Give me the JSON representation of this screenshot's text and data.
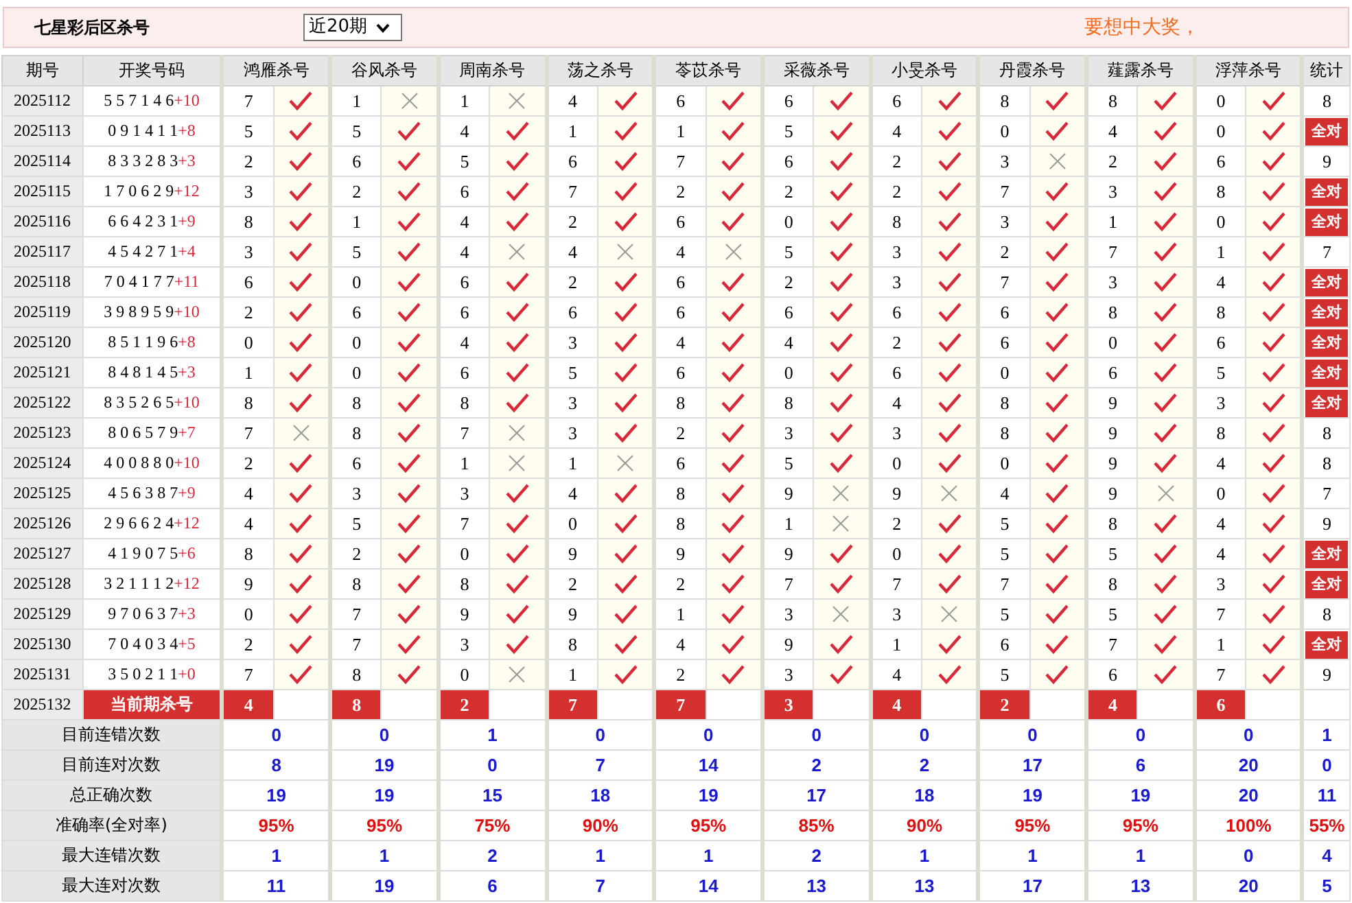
{
  "header": {
    "title": "七星彩后区杀号",
    "period_select": "近20期",
    "promo": "要想中大奖，"
  },
  "table": {
    "columns": [
      "期号",
      "开奖号码",
      "鸿雁杀号",
      "谷风杀号",
      "周南杀号",
      "荡之杀号",
      "苓苡杀号",
      "采薇杀号",
      "小旻杀号",
      "丹霞杀号",
      "薤露杀号",
      "浮萍杀号",
      "统计"
    ],
    "rows": [
      {
        "period": "2025112",
        "draw": "5 5 7 1 4 6",
        "bonus": "+10",
        "numbers": [
          "7",
          "1",
          "1",
          "4",
          "6",
          "6",
          "6",
          "8",
          "8",
          "0"
        ],
        "hits": [
          true,
          false,
          false,
          true,
          true,
          true,
          true,
          true,
          true,
          true
        ],
        "stat": {
          "kind": "count",
          "text": "8"
        }
      },
      {
        "period": "2025113",
        "draw": "0 9 1 4 1 1",
        "bonus": "+8",
        "numbers": [
          "5",
          "5",
          "4",
          "1",
          "1",
          "5",
          "4",
          "0",
          "4",
          "0"
        ],
        "hits": [
          true,
          true,
          true,
          true,
          true,
          true,
          true,
          true,
          true,
          true
        ],
        "stat": {
          "kind": "badge",
          "text": "全对"
        }
      },
      {
        "period": "2025114",
        "draw": "8 3 3 2 8 3",
        "bonus": "+3",
        "numbers": [
          "2",
          "6",
          "5",
          "6",
          "7",
          "6",
          "2",
          "3",
          "2",
          "6"
        ],
        "hits": [
          true,
          true,
          true,
          true,
          true,
          true,
          true,
          false,
          true,
          true
        ],
        "stat": {
          "kind": "count",
          "text": "9"
        }
      },
      {
        "period": "2025115",
        "draw": "1 7 0 6 2 9",
        "bonus": "+12",
        "numbers": [
          "3",
          "2",
          "6",
          "7",
          "2",
          "2",
          "2",
          "7",
          "3",
          "8"
        ],
        "hits": [
          true,
          true,
          true,
          true,
          true,
          true,
          true,
          true,
          true,
          true
        ],
        "stat": {
          "kind": "badge",
          "text": "全对"
        }
      },
      {
        "period": "2025116",
        "draw": "6 6 4 2 3 1",
        "bonus": "+9",
        "numbers": [
          "8",
          "1",
          "4",
          "2",
          "6",
          "0",
          "8",
          "3",
          "1",
          "0"
        ],
        "hits": [
          true,
          true,
          true,
          true,
          true,
          true,
          true,
          true,
          true,
          true
        ],
        "stat": {
          "kind": "badge",
          "text": "全对"
        }
      },
      {
        "period": "2025117",
        "draw": "4 5 4 2 7 1",
        "bonus": "+4",
        "numbers": [
          "3",
          "5",
          "4",
          "4",
          "4",
          "5",
          "3",
          "2",
          "7",
          "1"
        ],
        "hits": [
          true,
          true,
          false,
          false,
          false,
          true,
          true,
          true,
          true,
          true
        ],
        "stat": {
          "kind": "count",
          "text": "7"
        }
      },
      {
        "period": "2025118",
        "draw": "7 0 4 1 7 7",
        "bonus": "+11",
        "numbers": [
          "6",
          "0",
          "6",
          "2",
          "6",
          "2",
          "3",
          "7",
          "3",
          "4"
        ],
        "hits": [
          true,
          true,
          true,
          true,
          true,
          true,
          true,
          true,
          true,
          true
        ],
        "stat": {
          "kind": "badge",
          "text": "全对"
        }
      },
      {
        "period": "2025119",
        "draw": "3 9 8 9 5 9",
        "bonus": "+10",
        "numbers": [
          "2",
          "6",
          "6",
          "6",
          "6",
          "6",
          "6",
          "6",
          "8",
          "8"
        ],
        "hits": [
          true,
          true,
          true,
          true,
          true,
          true,
          true,
          true,
          true,
          true
        ],
        "stat": {
          "kind": "badge",
          "text": "全对"
        }
      },
      {
        "period": "2025120",
        "draw": "8 5 1 1 9 6",
        "bonus": "+8",
        "numbers": [
          "0",
          "0",
          "4",
          "3",
          "4",
          "4",
          "2",
          "6",
          "0",
          "6"
        ],
        "hits": [
          true,
          true,
          true,
          true,
          true,
          true,
          true,
          true,
          true,
          true
        ],
        "stat": {
          "kind": "badge",
          "text": "全对"
        }
      },
      {
        "period": "2025121",
        "draw": "8 4 8 1 4 5",
        "bonus": "+3",
        "numbers": [
          "1",
          "0",
          "6",
          "5",
          "6",
          "0",
          "6",
          "0",
          "6",
          "5"
        ],
        "hits": [
          true,
          true,
          true,
          true,
          true,
          true,
          true,
          true,
          true,
          true
        ],
        "stat": {
          "kind": "badge",
          "text": "全对"
        }
      },
      {
        "period": "2025122",
        "draw": "8 3 5 2 6 5",
        "bonus": "+10",
        "numbers": [
          "8",
          "8",
          "8",
          "3",
          "8",
          "8",
          "4",
          "8",
          "9",
          "3"
        ],
        "hits": [
          true,
          true,
          true,
          true,
          true,
          true,
          true,
          true,
          true,
          true
        ],
        "stat": {
          "kind": "badge",
          "text": "全对"
        }
      },
      {
        "period": "2025123",
        "draw": "8 0 6 5 7 9",
        "bonus": "+7",
        "numbers": [
          "7",
          "8",
          "7",
          "3",
          "2",
          "3",
          "3",
          "8",
          "9",
          "8"
        ],
        "hits": [
          false,
          true,
          false,
          true,
          true,
          true,
          true,
          true,
          true,
          true
        ],
        "stat": {
          "kind": "count",
          "text": "8"
        }
      },
      {
        "period": "2025124",
        "draw": "4 0 0 8 8 0",
        "bonus": "+10",
        "numbers": [
          "2",
          "6",
          "1",
          "1",
          "6",
          "5",
          "0",
          "0",
          "9",
          "4"
        ],
        "hits": [
          true,
          true,
          false,
          false,
          true,
          true,
          true,
          true,
          true,
          true
        ],
        "stat": {
          "kind": "count",
          "text": "8"
        }
      },
      {
        "period": "2025125",
        "draw": "4 5 6 3 8 7",
        "bonus": "+9",
        "numbers": [
          "4",
          "3",
          "3",
          "4",
          "8",
          "9",
          "9",
          "4",
          "9",
          "0"
        ],
        "hits": [
          true,
          true,
          true,
          true,
          true,
          false,
          false,
          true,
          false,
          true
        ],
        "stat": {
          "kind": "count",
          "text": "7"
        }
      },
      {
        "period": "2025126",
        "draw": "2 9 6 6 2 4",
        "bonus": "+12",
        "numbers": [
          "4",
          "5",
          "7",
          "0",
          "8",
          "1",
          "2",
          "5",
          "8",
          "4"
        ],
        "hits": [
          true,
          true,
          true,
          true,
          true,
          false,
          true,
          true,
          true,
          true
        ],
        "stat": {
          "kind": "count",
          "text": "9"
        }
      },
      {
        "period": "2025127",
        "draw": "4 1 9 0 7 5",
        "bonus": "+6",
        "numbers": [
          "8",
          "2",
          "0",
          "9",
          "9",
          "9",
          "0",
          "5",
          "5",
          "4"
        ],
        "hits": [
          true,
          true,
          true,
          true,
          true,
          true,
          true,
          true,
          true,
          true
        ],
        "stat": {
          "kind": "badge",
          "text": "全对"
        }
      },
      {
        "period": "2025128",
        "draw": "3 2 1 1 1 2",
        "bonus": "+12",
        "numbers": [
          "9",
          "8",
          "8",
          "2",
          "2",
          "7",
          "7",
          "7",
          "8",
          "3"
        ],
        "hits": [
          true,
          true,
          true,
          true,
          true,
          true,
          true,
          true,
          true,
          true
        ],
        "stat": {
          "kind": "badge",
          "text": "全对"
        }
      },
      {
        "period": "2025129",
        "draw": "9 7 0 6 3 7",
        "bonus": "+3",
        "numbers": [
          "0",
          "7",
          "9",
          "9",
          "1",
          "3",
          "3",
          "5",
          "5",
          "7"
        ],
        "hits": [
          true,
          true,
          true,
          true,
          true,
          false,
          false,
          true,
          true,
          true
        ],
        "stat": {
          "kind": "count",
          "text": "8"
        }
      },
      {
        "period": "2025130",
        "draw": "7 0 4 0 3 4",
        "bonus": "+5",
        "numbers": [
          "2",
          "7",
          "3",
          "8",
          "4",
          "9",
          "1",
          "6",
          "7",
          "1"
        ],
        "hits": [
          true,
          true,
          true,
          true,
          true,
          true,
          true,
          true,
          true,
          true
        ],
        "stat": {
          "kind": "badge",
          "text": "全对"
        }
      },
      {
        "period": "2025131",
        "draw": "3 5 0 2 1 1",
        "bonus": "+0",
        "numbers": [
          "7",
          "8",
          "0",
          "1",
          "2",
          "3",
          "4",
          "5",
          "6",
          "7"
        ],
        "hits": [
          true,
          true,
          false,
          true,
          true,
          true,
          true,
          true,
          true,
          true
        ],
        "stat": {
          "kind": "count",
          "text": "9"
        }
      }
    ],
    "current": {
      "period": "2025132",
      "label": "当前期杀号",
      "kills": [
        "4",
        "8",
        "2",
        "7",
        "7",
        "3",
        "4",
        "2",
        "4",
        "6"
      ]
    },
    "summary": [
      {
        "label": "目前连错次数",
        "kind": "count",
        "values": [
          "0",
          "0",
          "1",
          "0",
          "0",
          "0",
          "0",
          "0",
          "0",
          "0",
          "1"
        ]
      },
      {
        "label": "目前连对次数",
        "kind": "count",
        "values": [
          "8",
          "19",
          "0",
          "7",
          "14",
          "2",
          "2",
          "17",
          "6",
          "20",
          "0"
        ]
      },
      {
        "label": "总正确次数",
        "kind": "count",
        "values": [
          "19",
          "19",
          "15",
          "18",
          "19",
          "17",
          "18",
          "19",
          "19",
          "20",
          "11"
        ]
      },
      {
        "label": "准确率(全对率)",
        "kind": "rate",
        "values": [
          "95%",
          "95%",
          "75%",
          "90%",
          "95%",
          "85%",
          "90%",
          "95%",
          "95%",
          "100%",
          "55%"
        ]
      },
      {
        "label": "最大连错次数",
        "kind": "count",
        "values": [
          "1",
          "1",
          "2",
          "1",
          "1",
          "2",
          "1",
          "1",
          "1",
          "0",
          "4"
        ]
      },
      {
        "label": "最大连对次数",
        "kind": "count",
        "values": [
          "11",
          "19",
          "6",
          "7",
          "14",
          "13",
          "13",
          "17",
          "13",
          "20",
          "5"
        ]
      }
    ]
  }
}
